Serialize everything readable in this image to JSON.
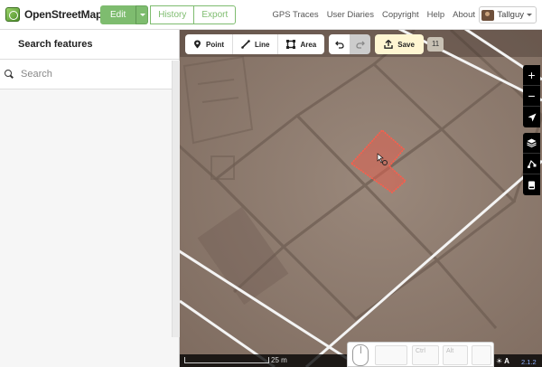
{
  "navbar": {
    "brand": "OpenStreetMap",
    "edit_label": "Edit",
    "history_label": "History",
    "export_label": "Export",
    "links": [
      "GPS Traces",
      "User Diaries",
      "Copyright",
      "Help",
      "About"
    ],
    "user_name": "Tallguy"
  },
  "sidebar": {
    "title": "Search features",
    "search_placeholder": "Search"
  },
  "toolbar": {
    "point_label": "Point",
    "line_label": "Line",
    "area_label": "Area",
    "save_label": "Save",
    "edit_count": "11"
  },
  "map_controls": {
    "zoom_in": "+",
    "zoom_out": "−"
  },
  "footer": {
    "scale_label": "25 m",
    "version": "2.1.2"
  },
  "keyboard_overlay": {
    "key1": "",
    "ctrl": "Ctrl",
    "alt": "Alt"
  },
  "colors": {
    "accent_green": "#7ebc6f",
    "save_bg": "#fff6d2",
    "selected_area": "#e06050"
  }
}
